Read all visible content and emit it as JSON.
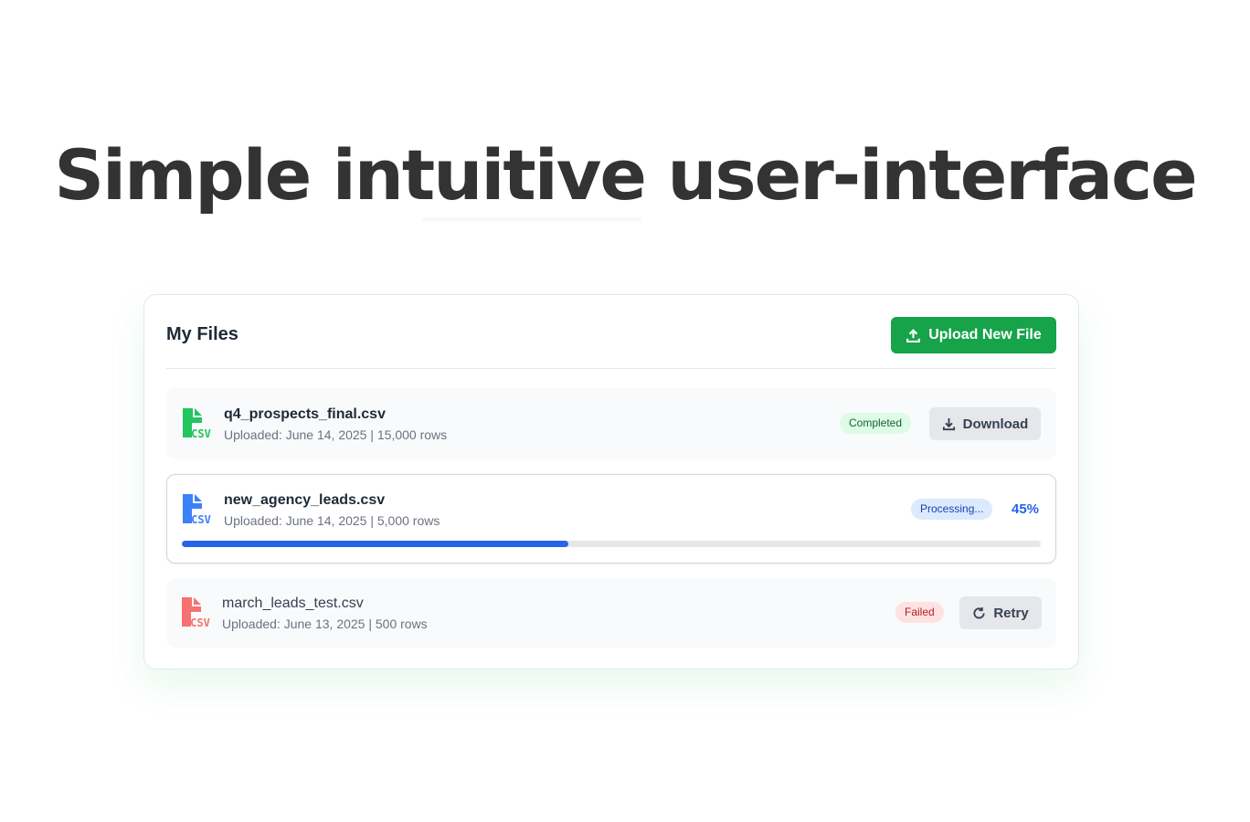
{
  "hero": {
    "title": "Simple intuitive user-interface"
  },
  "card": {
    "title": "My Files",
    "upload_label": "Upload New File"
  },
  "files": [
    {
      "name": "q4_prospects_final.csv",
      "meta": "Uploaded: June 14, 2025 | 15,000 rows",
      "icon": "csv-file-icon",
      "icon_color": "#22c55e",
      "status": "Completed",
      "action": "Download"
    },
    {
      "name": "new_agency_leads.csv",
      "meta": "Uploaded: June 14, 2025 | 5,000 rows",
      "icon": "csv-file-icon",
      "icon_color": "#3b82f6",
      "status": "Processing...",
      "progress_label": "45%",
      "progress": 0.45
    },
    {
      "name": "march_leads_test.csv",
      "meta": "Uploaded: June 13, 2025 | 500 rows",
      "icon": "csv-file-icon",
      "icon_color": "#f87171",
      "status": "Failed",
      "action": "Retry"
    }
  ],
  "colors": {
    "accent": "#16a34a",
    "progress": "#2563eb",
    "completed": "#dcfce7",
    "processing": "#dbeafe",
    "failed": "#fee2e2"
  }
}
